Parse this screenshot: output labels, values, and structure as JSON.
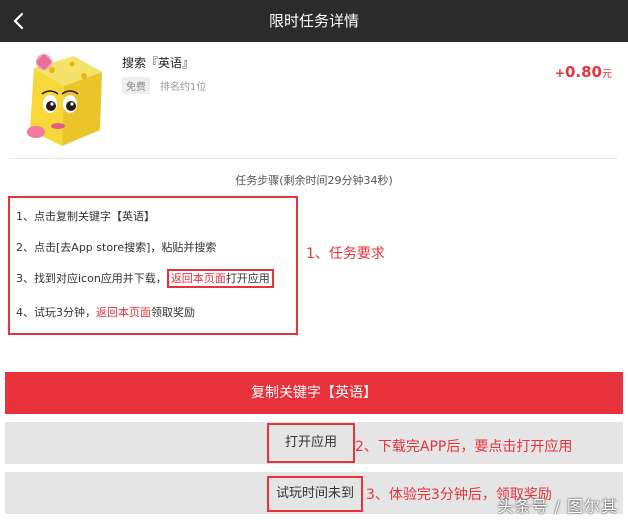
{
  "nav": {
    "title": "限时任务详情",
    "back_icon": "chevron-left-icon"
  },
  "app": {
    "name": "搜索『英语』",
    "tag": "免费",
    "rank": "排名约1位",
    "reward_sign": "+",
    "reward_amount": "0.80",
    "reward_unit": "元",
    "logo_icon": "cartoon-cube-logo"
  },
  "steps": {
    "title": "任务步骤(剩余时间29分钟34秒)",
    "s1": "1、点击复制关键字【英语】",
    "s2": "2、点击[去App store搜索]，粘贴并搜索",
    "s3_prefix": "3、找到对应icon应用并下载，",
    "s3_highlight": "返回本页面",
    "s3_suffix": "打开应用",
    "s4_prefix": "4、试玩3分钟，",
    "s4_highlight": "返回本页面",
    "s4_suffix": "领取奖励"
  },
  "annotations": {
    "a1": "1、任务要求",
    "a2": "2、下载完APP后，要点击打开应用",
    "a3": "3、体验完3分钟后，领取奖励"
  },
  "buttons": {
    "copy": "复制关键字【英语】",
    "open": "打开应用",
    "trial": "试玩时间未到"
  },
  "watermark": "头条号 / 图尔其",
  "colors": {
    "accent": "#e8323c",
    "navbar": "#2b2b2b",
    "button_grey": "#e5e5e5"
  }
}
